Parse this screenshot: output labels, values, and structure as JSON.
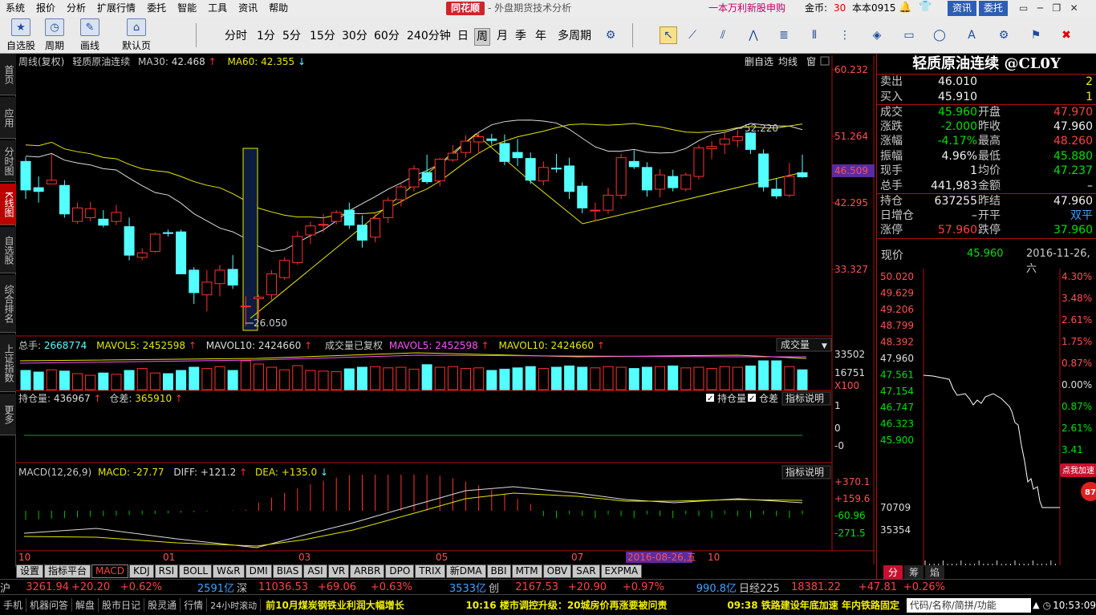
{
  "menu": [
    "系统",
    "报价",
    "分析",
    "扩展行情",
    "委托",
    "智能",
    "工具",
    "资讯",
    "帮助"
  ],
  "brand": {
    "logo": "同花顺",
    "subtitle": "- 外盘期货技术分析",
    "promo": "一本万利新股申购",
    "coins_label": "金币:",
    "coins_value": "30",
    "account": "本本0915",
    "info_btn": "资讯",
    "trade_btn": "委托"
  },
  "toolbar": {
    "buttons": [
      "自选股",
      "周期",
      "画线",
      "默认页"
    ],
    "periods": [
      "分时",
      "1分",
      "5分",
      "15分",
      "30分",
      "60分",
      "240分钟",
      "日",
      "周",
      "月",
      "季",
      "年",
      "多周期"
    ],
    "selected_period": "周"
  },
  "sidenav": [
    "首页",
    "应用",
    "分时图",
    "K线图",
    "自选股",
    "综合排名",
    "上证指数",
    "更多"
  ],
  "kchart": {
    "header": {
      "title": "周线(复权)",
      "name": "轻质原油连续",
      "ma30_label": "MA30:",
      "ma30": "42.468",
      "ma30_arrow": "↑",
      "ma60_label": "MA60:",
      "ma60": "42.355",
      "ma60_arrow": "↓"
    },
    "top_buttons": [
      "删自选",
      "均线",
      "窗"
    ],
    "y_ticks": [
      "60.232",
      "51.264",
      "42.295",
      "33.327"
    ],
    "current_price": "46.509",
    "high_label": "52.220",
    "low_label": "26.050"
  },
  "volume": {
    "label": "总手:",
    "value": "2668774",
    "mavol5_label": "MAVOL5:",
    "mavol5": "2452598",
    "mavol10_label": "MAVOL10:",
    "mavol10": "2424660",
    "extra": "成交量已复权",
    "mavol5b_label": "MAVOL5:",
    "mavol5b": "2452598",
    "mavol10b_label": "MAVOL10:",
    "mavol10b": "2424660",
    "dropdown": "成交量",
    "y_ticks": [
      "33502",
      "16751"
    ],
    "unit": "X100"
  },
  "oi": {
    "label": "持仓量:",
    "value": "436967",
    "diff_label": "仓差:",
    "diff": "365910",
    "checkbox1": "持仓量",
    "checkbox2": "仓差",
    "explain": "指标说明",
    "y_ticks": [
      "1",
      "0",
      "-0"
    ]
  },
  "macd": {
    "label": "MACD(12,26,9)",
    "macd_label": "MACD:",
    "macd": "-27.77",
    "diff_label": "DIFF:",
    "diff": "+121.2",
    "dea_label": "DEA:",
    "dea": "+135.0",
    "explain": "指标说明",
    "y_ticks": [
      "+370.1",
      "+159.6",
      "-60.96",
      "-271.5"
    ]
  },
  "xaxis": {
    "labels": [
      "10",
      "01",
      "03",
      "05",
      "07",
      "10"
    ],
    "cursor_date": "2016-08-26,五"
  },
  "indicator_tabs": [
    "设置",
    "指标平台",
    "MACD",
    "KDJ",
    "RSI",
    "BOLL",
    "W&R",
    "DMI",
    "BIAS",
    "ASI",
    "VR",
    "ARBR",
    "DPO",
    "TRIX",
    "新DMA",
    "BBI",
    "MTM",
    "OBV",
    "SAR",
    "EXPMA"
  ],
  "active_indicator": "MACD",
  "quote": {
    "title": "轻质原油连续 @CL0Y",
    "rows": [
      {
        "l1": "卖出",
        "v1": "46.010",
        "v1c": "#f0f0f0",
        "l2": "",
        "v2": "2",
        "v2c": "#f0f000"
      },
      {
        "l1": "买入",
        "v1": "45.910",
        "v1c": "#f0f0f0",
        "l2": "",
        "v2": "1",
        "v2c": "#f0f000"
      },
      {
        "l1": "成交",
        "v1": "45.960",
        "v1c": "#00e000",
        "l2": "开盘",
        "v2": "47.970",
        "v2c": "#ff4040"
      },
      {
        "l1": "涨跌",
        "v1": "-2.000",
        "v1c": "#00e000",
        "l2": "昨收",
        "v2": "47.960",
        "v2c": "#f0f0f0"
      },
      {
        "l1": "涨幅",
        "v1": "-4.17%",
        "v1c": "#00e000",
        "l2": "最高",
        "v2": "48.260",
        "v2c": "#ff4040"
      },
      {
        "l1": "振幅",
        "v1": "4.96%",
        "v1c": "#f0f0f0",
        "l2": "最低",
        "v2": "45.880",
        "v2c": "#00e000"
      },
      {
        "l1": "现手",
        "v1": "1",
        "v1c": "#f0f0f0",
        "l2": "均价",
        "v2": "47.237",
        "v2c": "#00e000"
      },
      {
        "l1": "总手",
        "v1": "441,983",
        "v1c": "#f0f0f0",
        "l2": "金额",
        "v2": "–",
        "v2c": "#f0f0f0"
      },
      {
        "l1": "持仓",
        "v1": "637255",
        "v1c": "#f0f0f0",
        "l2": "昨结",
        "v2": "47.960",
        "v2c": "#f0f0f0"
      },
      {
        "l1": "日增仓",
        "v1": "–",
        "v1c": "#f0f0f0",
        "l2": "开平",
        "v2": "双平",
        "v2c": "#40a0ff"
      },
      {
        "l1": "涨停",
        "v1": "57.960",
        "v1c": "#ff4040",
        "l2": "跌停",
        "v2": "37.960",
        "v2c": "#00e000"
      }
    ],
    "now_label": "现价",
    "now_value": "45.960",
    "date": "2016-11-26,六"
  },
  "mini": {
    "left_ticks": [
      "50.020",
      "49.629",
      "49.206",
      "48.799",
      "48.392",
      "47.960",
      "47.561",
      "47.154",
      "46.747",
      "46.323",
      "45.900",
      "70709",
      "35354"
    ],
    "right_ticks": [
      "4.30%",
      "3.48%",
      "2.61%",
      "1.75%",
      "0.87%",
      "0.00%",
      "0.87%",
      "2.61%",
      "3.41",
      "4.30%"
    ],
    "badge": "点我加速",
    "badge_num": "87",
    "tabs": [
      "分",
      "筹",
      "焰"
    ]
  },
  "ticker": [
    {
      "t": "沪",
      "c": "#c8c8c8"
    },
    {
      "t": "3261.94",
      "c": "#ff4040"
    },
    {
      "t": "+20.20",
      "c": "#ff4040"
    },
    {
      "t": "+0.62%",
      "c": "#ff4040"
    },
    {
      "t": "2591亿",
      "c": "#40a0ff"
    },
    {
      "t": "深",
      "c": "#c8c8c8"
    },
    {
      "t": "11036.53",
      "c": "#ff4040"
    },
    {
      "t": "+69.06",
      "c": "#ff4040"
    },
    {
      "t": "+0.63%",
      "c": "#ff4040"
    },
    {
      "t": "3533亿",
      "c": "#40a0ff"
    },
    {
      "t": "创",
      "c": "#c8c8c8"
    },
    {
      "t": "2167.53",
      "c": "#ff4040"
    },
    {
      "t": "+20.90",
      "c": "#ff4040"
    },
    {
      "t": "+0.97%",
      "c": "#ff4040"
    },
    {
      "t": "990.8亿",
      "c": "#40a0ff"
    },
    {
      "t": "日经225",
      "c": "#c8c8c8"
    },
    {
      "t": "18381.22",
      "c": "#ff4040"
    },
    {
      "t": "+47.81",
      "c": "#ff4040"
    },
    {
      "t": "+0.26%",
      "c": "#ff4040"
    }
  ],
  "bottom": {
    "buttons": [
      "手机",
      "机器问答",
      "解盘",
      "股市日记",
      "股灵通",
      "行情",
      "24小时滚动"
    ],
    "news1": "前10月煤炭钢铁业利润大幅增长",
    "news2": "10:16 楼市调控升级：20城房价再涨要被问责",
    "news3": "09:38 铁路建设年底加速 年内铁路固定",
    "search": "代码/名称/简拼/功能",
    "clock": "10:53:09"
  },
  "colors": {
    "up": "#ff3030",
    "down": "#54ffff",
    "ma_white": "#e0e0e0",
    "ma_yellow": "#e6e600"
  },
  "chart_data": {
    "type": "candlestick",
    "title": "轻质原油连续 周线(复权)",
    "ohlc": [
      [
        48.0,
        48.6,
        43.0,
        44.2
      ],
      [
        44.5,
        46.0,
        42.5,
        44.0
      ],
      [
        45.0,
        49.0,
        45.0,
        45.5
      ],
      [
        44.8,
        45.5,
        40.5,
        41.0
      ],
      [
        40.0,
        42.5,
        39.7,
        41.8
      ],
      [
        40.5,
        42.6,
        40.0,
        41.7
      ],
      [
        40.3,
        41.5,
        39.2,
        39.5
      ],
      [
        40.0,
        42.2,
        39.5,
        41.2
      ],
      [
        39.3,
        40.5,
        34.8,
        35.5
      ],
      [
        35.2,
        36.4,
        34.8,
        35.8
      ],
      [
        36.0,
        38.5,
        35.8,
        38.3
      ],
      [
        38.5,
        38.9,
        38.0,
        38.4
      ],
      [
        38.6,
        38.9,
        33.0,
        33.0
      ],
      [
        33.5,
        33.9,
        29.0,
        30.5
      ],
      [
        30.2,
        33.5,
        28.0,
        31.9
      ],
      [
        31.7,
        34.2,
        30.0,
        33.5
      ],
      [
        33.6,
        35.5,
        31.0,
        31.5
      ],
      [
        28.7,
        30.0,
        26.05,
        28.7
      ],
      [
        29.7,
        30.2,
        27.0,
        29.9
      ],
      [
        30.2,
        33.5,
        29.5,
        33.0
      ],
      [
        32.5,
        35.2,
        32.2,
        34.8
      ],
      [
        34.5,
        38.7,
        34.2,
        38.0
      ],
      [
        38.2,
        40.0,
        37.0,
        39.4
      ],
      [
        39.5,
        41.0,
        38.5,
        39.6
      ],
      [
        40.0,
        41.5,
        39.6,
        41.2
      ],
      [
        41.5,
        42.5,
        39.0,
        39.5
      ],
      [
        39.5,
        40.8,
        36.5,
        37.5
      ],
      [
        37.9,
        41.0,
        37.2,
        40.4
      ],
      [
        40.5,
        43.2,
        39.8,
        42.8
      ],
      [
        42.9,
        45.0,
        42.0,
        44.6
      ],
      [
        44.6,
        47.5,
        44.0,
        47.0
      ],
      [
        46.5,
        48.9,
        45.0,
        45.3
      ],
      [
        45.4,
        48.5,
        44.7,
        48.3
      ],
      [
        48.2,
        50.2,
        47.9,
        49.1
      ],
      [
        49.2,
        51.5,
        48.5,
        50.7
      ],
      [
        50.6,
        51.8,
        49.0,
        51.3
      ],
      [
        51.0,
        51.7,
        50.2,
        50.8
      ],
      [
        50.4,
        51.6,
        47.5,
        48.0
      ],
      [
        49.2,
        51.0,
        47.4,
        48.5
      ],
      [
        48.4,
        49.2,
        45.0,
        45.5
      ],
      [
        45.4,
        48.0,
        44.8,
        47.2
      ],
      [
        47.1,
        49.0,
        46.5,
        47.0
      ],
      [
        47.4,
        48.5,
        43.0,
        44.0
      ],
      [
        44.7,
        45.2,
        41.1,
        41.8
      ],
      [
        41.4,
        42.5,
        40.0,
        41.5
      ],
      [
        41.5,
        44.5,
        41.0,
        43.5
      ],
      [
        43.5,
        49.0,
        43.0,
        48.5
      ],
      [
        48.0,
        49.5,
        47.0,
        47.3
      ],
      [
        47.2,
        47.9,
        43.3,
        44.2
      ],
      [
        44.3,
        47.0,
        43.2,
        46.2
      ],
      [
        46.0,
        46.9,
        44.0,
        44.5
      ],
      [
        44.3,
        46.5,
        44.0,
        46.2
      ],
      [
        46.0,
        50.2,
        45.6,
        49.8
      ],
      [
        49.7,
        50.7,
        48.3,
        50.0
      ],
      [
        50.3,
        51.8,
        49.0,
        51.0
      ],
      [
        50.8,
        52.22,
        49.9,
        51.3
      ],
      [
        51.8,
        51.9,
        49.0,
        49.6
      ],
      [
        49.0,
        49.6,
        44.0,
        44.6
      ],
      [
        44.3,
        45.8,
        43.0,
        43.4
      ],
      [
        43.5,
        47.8,
        43.2,
        46.0
      ],
      [
        46.5,
        48.9,
        45.8,
        45.96
      ]
    ],
    "ma30": [],
    "yrange": [
      26.0,
      60.232
    ]
  }
}
